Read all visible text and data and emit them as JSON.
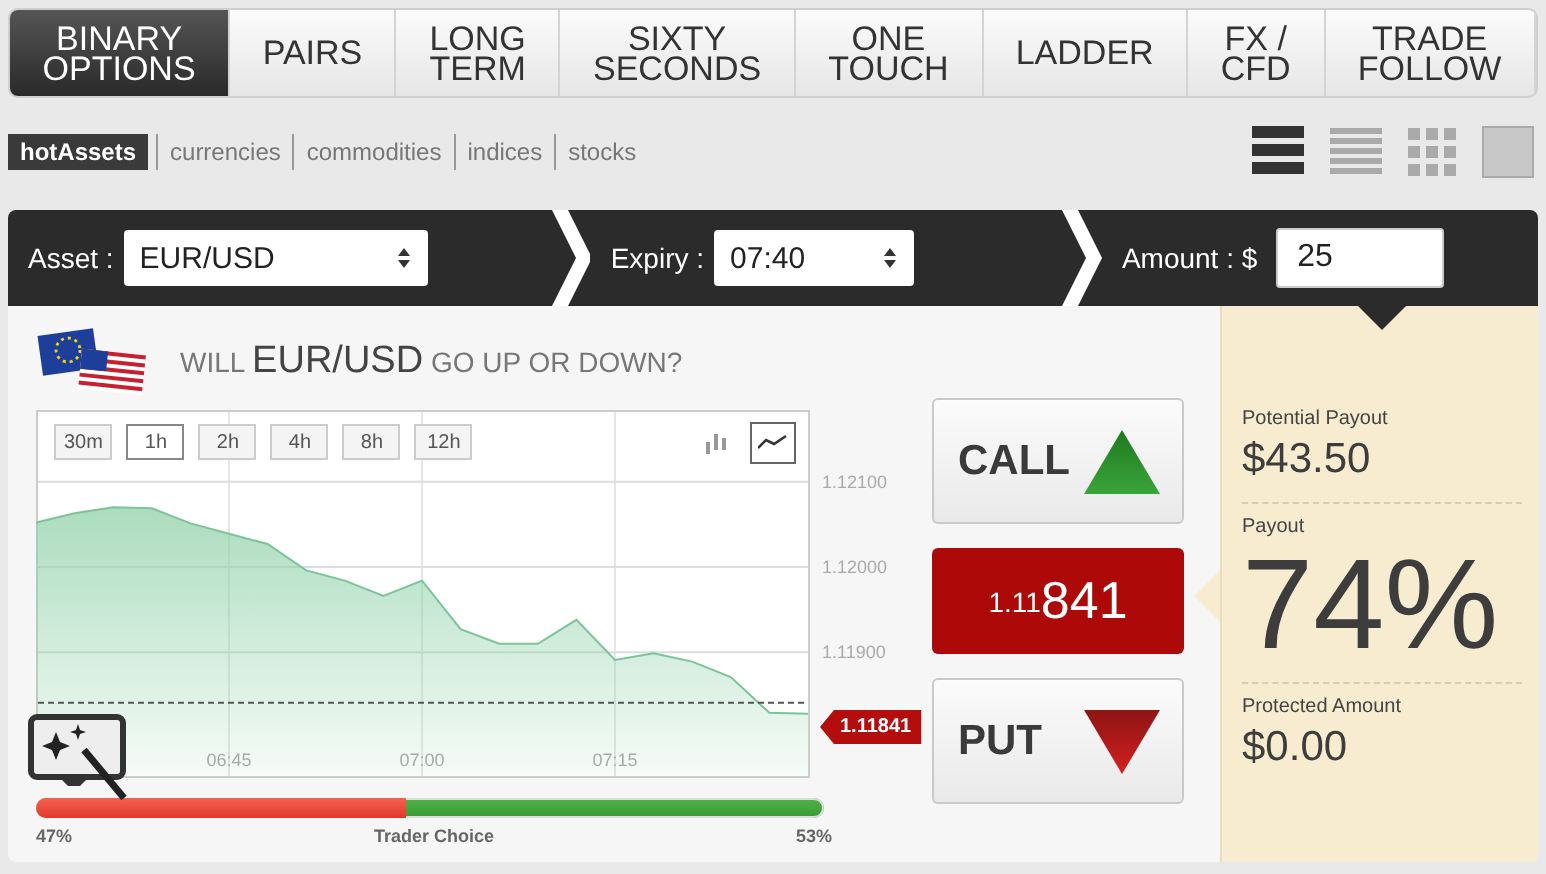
{
  "nav_tabs": [
    {
      "label": "BINARY OPTIONS",
      "selected": true
    },
    {
      "label": "PAIRS",
      "selected": false
    },
    {
      "label": "LONG TERM",
      "selected": false
    },
    {
      "label": "SIXTY SECONDS",
      "selected": false
    },
    {
      "label": "ONE TOUCH",
      "selected": false
    },
    {
      "label": "LADDER",
      "selected": false
    },
    {
      "label": "FX / CFD",
      "selected": false
    },
    {
      "label": "TRADE FOLLOW",
      "selected": false
    }
  ],
  "asset_filters": [
    {
      "label": "hotAssets",
      "selected": true
    },
    {
      "label": "currencies",
      "selected": false
    },
    {
      "label": "commodities",
      "selected": false
    },
    {
      "label": "indices",
      "selected": false
    },
    {
      "label": "stocks",
      "selected": false
    }
  ],
  "view_options": [
    {
      "kind": "thick-rows",
      "selected": true
    },
    {
      "kind": "thin-rows",
      "selected": false
    },
    {
      "kind": "grid",
      "selected": false
    },
    {
      "kind": "tile",
      "selected": false
    }
  ],
  "trade_bar": {
    "asset": {
      "label": "Asset :",
      "value": "EUR/USD"
    },
    "expiry": {
      "label": "Expiry :",
      "value": "07:40"
    },
    "amount": {
      "label": "Amount : $",
      "value": "25"
    }
  },
  "question": {
    "prefix": "WILL",
    "asset": "EUR/USD",
    "suffix": "GO UP OR DOWN?"
  },
  "time_ranges": [
    {
      "label": "30m",
      "selected": false
    },
    {
      "label": "1h",
      "selected": true
    },
    {
      "label": "2h",
      "selected": false
    },
    {
      "label": "4h",
      "selected": false
    },
    {
      "label": "8h",
      "selected": false
    },
    {
      "label": "12h",
      "selected": false
    }
  ],
  "chart_types": [
    {
      "kind": "candlestick",
      "selected": false
    },
    {
      "kind": "line",
      "selected": true
    }
  ],
  "chart_data": {
    "type": "area",
    "categories": [
      null,
      null,
      null,
      null,
      null,
      "06:45",
      null,
      null,
      null,
      null,
      "07:00",
      null,
      null,
      null,
      null,
      "07:15",
      null,
      null,
      null,
      null,
      null
    ],
    "series": [
      {
        "color": "#8fd1a8",
        "values": [
          1.12052,
          1.12063,
          1.1207,
          1.12069,
          1.12051,
          1.12039,
          1.12027,
          1.11996,
          1.11984,
          1.11966,
          1.11984,
          1.11927,
          1.1191,
          1.1191,
          1.11938,
          1.11891,
          1.11899,
          1.11889,
          1.11871,
          1.11829,
          1.11828
        ]
      }
    ],
    "ylim": [
      1.11755,
      1.12184
    ],
    "grid": true,
    "ref_lines": [
      {
        "axis": "y",
        "value": 1.11841
      }
    ],
    "yticks": [
      {
        "value": 1.121,
        "label": "1.12100"
      },
      {
        "value": 1.12,
        "label": "1.12000"
      },
      {
        "value": 1.119,
        "label": "1.11900"
      }
    ]
  },
  "price_tag": "1.11841",
  "trader_choice": {
    "put_share": "47%",
    "title": "Trader Choice",
    "call_share": "53%",
    "level": 0.47
  },
  "call_button": "CALL",
  "current_price": {
    "head": "1.11",
    "tail": "841"
  },
  "put_button": "PUT",
  "payout": [
    {
      "label": "Potential Payout",
      "value": "$43.50",
      "kind": "normal"
    },
    {
      "label": "Payout",
      "value": "74%",
      "kind": "big"
    },
    {
      "label": "Protected Amount",
      "value": "$0.00",
      "kind": "normal"
    }
  ]
}
